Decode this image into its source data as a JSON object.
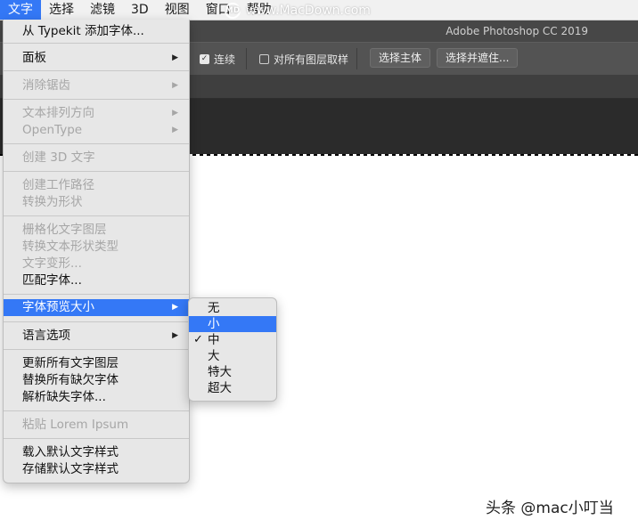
{
  "menubar": {
    "items": [
      "文字",
      "选择",
      "滤镜",
      "3D",
      "视图",
      "窗口",
      "帮助"
    ],
    "active_index": 0
  },
  "watermark": {
    "text": "www.MacDown.com",
    "logo": "MD"
  },
  "window": {
    "title": "Adobe Photoshop CC 2019"
  },
  "options": {
    "contiguous_label": "连续",
    "contiguous_checked": true,
    "sample_all_layers_label": "对所有图层取样",
    "sample_all_layers_checked": false,
    "select_subject_label": "选择主体",
    "select_and_mask_label": "选择并遮住...",
    "check_glyph": "✓"
  },
  "menu": {
    "items": [
      {
        "label": "从 Typekit 添加字体...",
        "disabled": false,
        "submenu": false
      },
      {
        "label": "面板",
        "disabled": false,
        "submenu": true
      },
      {
        "label": "消除锯齿",
        "disabled": true,
        "submenu": true
      },
      {
        "label": "文本排列方向",
        "disabled": true,
        "submenu": true
      },
      {
        "label": "OpenType",
        "disabled": true,
        "submenu": true
      },
      {
        "label": "创建 3D 文字",
        "disabled": true,
        "submenu": false
      },
      {
        "label": "创建工作路径",
        "disabled": true,
        "submenu": false
      },
      {
        "label": "转换为形状",
        "disabled": true,
        "submenu": false
      },
      {
        "label": "栅格化文字图层",
        "disabled": true,
        "submenu": false
      },
      {
        "label": "转换文本形状类型",
        "disabled": true,
        "submenu": false
      },
      {
        "label": "文字变形...",
        "disabled": true,
        "submenu": false
      },
      {
        "label": "匹配字体...",
        "disabled": false,
        "submenu": false
      },
      {
        "label": "字体预览大小",
        "disabled": false,
        "submenu": true,
        "highlighted": true
      },
      {
        "label": "语言选项",
        "disabled": false,
        "submenu": true
      },
      {
        "label": "更新所有文字图层",
        "disabled": false,
        "submenu": false
      },
      {
        "label": "替换所有缺欠字体",
        "disabled": false,
        "submenu": false
      },
      {
        "label": "解析缺失字体...",
        "disabled": false,
        "submenu": false
      },
      {
        "label": "粘贴 Lorem Ipsum",
        "disabled": true,
        "submenu": false
      },
      {
        "label": "载入默认文字样式",
        "disabled": false,
        "submenu": false
      },
      {
        "label": "存储默认文字样式",
        "disabled": false,
        "submenu": false
      }
    ],
    "arrow_glyph": "▶"
  },
  "submenu": {
    "items": [
      "无",
      "小",
      "中",
      "大",
      "特大",
      "超大"
    ],
    "highlighted_index": 1,
    "checked_index": 2,
    "check_glyph": "✓"
  },
  "footer": {
    "text": "头条 @mac小叮当"
  },
  "colors": {
    "highlight": "#3478f6",
    "menu_bg": "#e7e7e7",
    "disabled_text": "#a6a6a6",
    "options_bar": "#535353",
    "title_bar": "#474747",
    "doc_area": "#2b2b2b"
  }
}
